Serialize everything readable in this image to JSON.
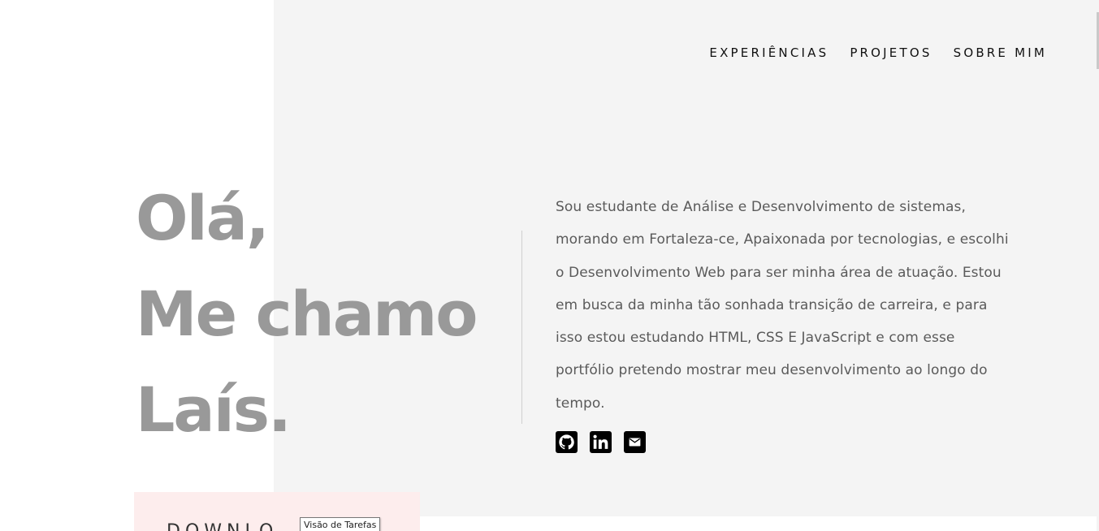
{
  "nav": {
    "items": [
      "EXPERIÊNCIAS",
      "PROJETOS",
      "SOBRE MIM"
    ]
  },
  "hero": {
    "line1": "Olá,",
    "line2": "Me chamo",
    "line3": "Laís.",
    "bio": "Sou estudante de Análise e Desenvolvimento de sistemas, morando em Fortaleza-ce, Apaixonada por tecnologias, e escolhi o Desenvolvimento Web para ser minha área de atuação. Estou em busca da minha tão sonhada transição de carreira, e para isso estou estudando HTML, CSS E JavaScript e com esse portfólio pretendo mostrar meu desenvolvimento ao longo do tempo."
  },
  "socials": [
    {
      "icon": "github-icon"
    },
    {
      "icon": "linkedin-icon"
    },
    {
      "icon": "mail-icon"
    }
  ],
  "bottom": {
    "download_label": "DOWNLO"
  },
  "tooltip": {
    "text": "Visão de Tarefas"
  },
  "colors": {
    "headline": "#999999",
    "panel": "#f4f4f4",
    "accent_pink": "#fdeded"
  }
}
